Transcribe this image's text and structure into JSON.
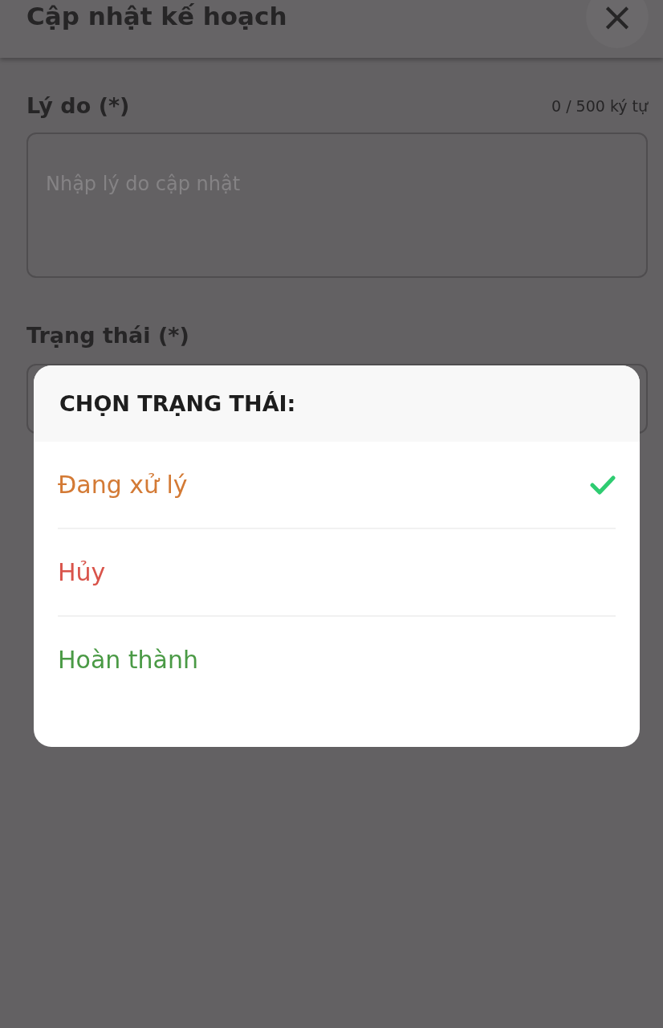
{
  "header": {
    "title": "Cập nhật kế hoạch",
    "close": "×"
  },
  "reason": {
    "label": "Lý do (*)",
    "counter": "0 / 500 ký tự",
    "placeholder": "Nhập lý do cập nhật"
  },
  "status": {
    "label": "Trạng thái (*)"
  },
  "dialog": {
    "title": "CHỌN TRẠNG THÁI:",
    "options": [
      {
        "label": "Đang xử lý",
        "color": "#d37a35",
        "selected": true
      },
      {
        "label": "Hủy",
        "color": "#d9534a",
        "selected": false
      },
      {
        "label": "Hoàn thành",
        "color": "#4a9a45",
        "selected": false
      }
    ]
  }
}
